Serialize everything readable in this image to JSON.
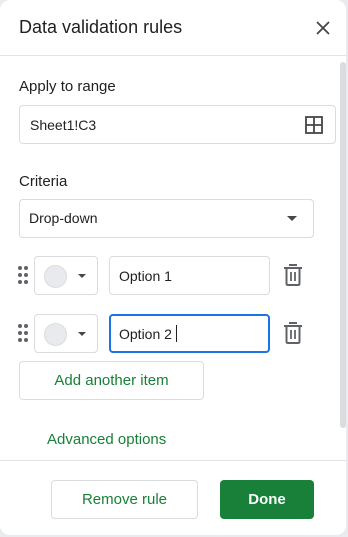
{
  "header": {
    "title": "Data validation rules",
    "close_icon": "close-icon"
  },
  "range": {
    "label": "Apply to range",
    "value": "Sheet1!C3",
    "icon": "grid-select-icon"
  },
  "criteria": {
    "label": "Criteria",
    "selected": "Drop-down"
  },
  "items": [
    {
      "value": "Option 1",
      "color": "#e8eaed",
      "focused": false
    },
    {
      "value": "Option 2",
      "color": "#e8eaed",
      "focused": true
    }
  ],
  "add_item_label": "Add another item",
  "advanced_label": "Advanced options",
  "footer": {
    "remove_label": "Remove rule",
    "done_label": "Done"
  },
  "colors": {
    "accent_green": "#188038",
    "focus_blue": "#1a73e8",
    "border": "#dadce0"
  }
}
